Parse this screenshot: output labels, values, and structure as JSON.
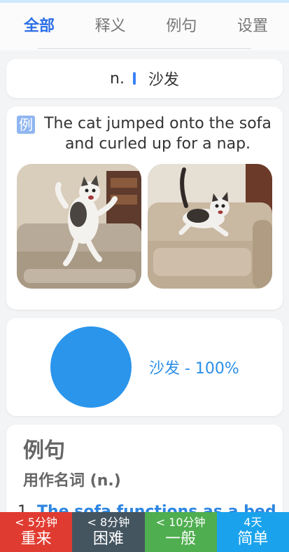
{
  "tabs": [
    "全部",
    "释义",
    "例句",
    "设置"
  ],
  "definition": {
    "pos": "n.",
    "meaning": "沙发"
  },
  "example": {
    "badge": "例",
    "sentence": "The cat jumped onto the sofa and curled up for a nap."
  },
  "distribution": {
    "label": "沙发 - 100%",
    "value": 100,
    "color": "#2b95ec"
  },
  "sentences": {
    "heading": "例句",
    "subheading": "用作名词 (n.)",
    "items": [
      {
        "number": "1.",
        "text": "The sofa functions as a bed"
      }
    ]
  },
  "review_buttons": [
    {
      "time": "< 5分钟",
      "label": "重来",
      "color": "#e03b30"
    },
    {
      "time": "< 8分钟",
      "label": "困难",
      "color": "#455560"
    },
    {
      "time": "< 10分钟",
      "label": "一般",
      "color": "#4fae4f"
    },
    {
      "time": "4天",
      "label": "简单",
      "color": "#1aa3ec"
    }
  ]
}
